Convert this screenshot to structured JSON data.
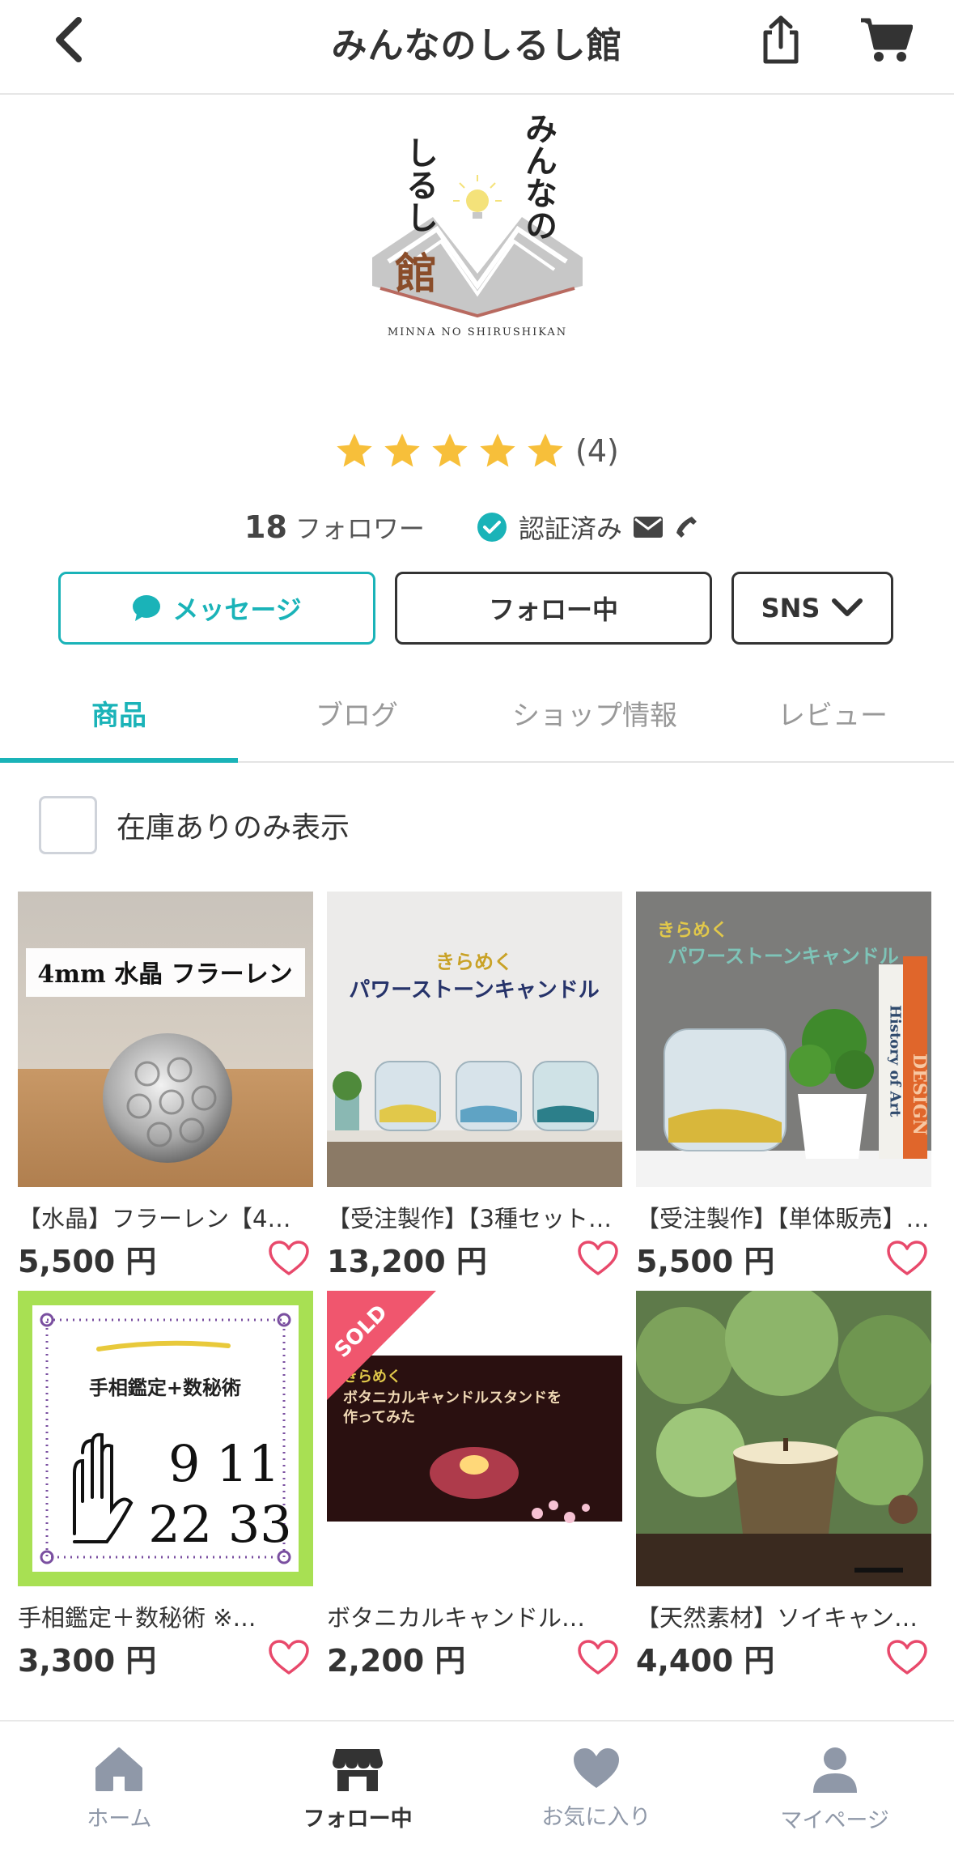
{
  "header": {
    "title": "みんなのしるし館"
  },
  "shop": {
    "logo": {
      "text_vertical_1": "みんなの",
      "text_vertical_2": "しるし",
      "text_kan": "館",
      "romaji": "MINNA NO SHIRUSHIKAN"
    },
    "rating": {
      "stars": 5,
      "count_text": "(4)"
    },
    "followers": {
      "count": "18",
      "label": "フォロワー"
    },
    "verified_label": "認証済み"
  },
  "buttons": {
    "message": "メッセージ",
    "follow": "フォロー中",
    "sns": "SNS"
  },
  "tabs": [
    {
      "label": "商品",
      "active": true
    },
    {
      "label": "ブログ",
      "active": false
    },
    {
      "label": "ショップ情報",
      "active": false
    },
    {
      "label": "レビュー",
      "active": false
    }
  ],
  "filter": {
    "in_stock_label": "在庫ありのみ表示",
    "checked": false
  },
  "products": [
    {
      "name": "【水晶】フラーレン【4m…",
      "price": "5,500 円",
      "image_caption": "4mm 水晶 フラーレン",
      "sold": false
    },
    {
      "name": "【受注製作】【3種セット…",
      "price": "13,200 円",
      "image_caption_top": "きらめく",
      "image_caption": "パワーストーンキャンドル",
      "sold": false
    },
    {
      "name": "【受注製作】【単体販売】…",
      "price": "5,500 円",
      "image_caption_top": "きらめく",
      "image_caption": "パワーストーンキャンドル",
      "book_text_1": "History of Art",
      "book_text_2": "DESIGN",
      "sold": false
    },
    {
      "name": "手相鑑定＋数秘術 ※…",
      "price": "3,300 円",
      "image_caption": "手相鑑定+数秘術",
      "image_numbers_1": "9 11",
      "image_numbers_2": "22 33",
      "sold": false
    },
    {
      "name": "ボタニカルキャンドル…",
      "price": "2,200 円",
      "image_caption_top": "きらめく",
      "image_caption": "ボタニカルキャンドルスタンドを",
      "image_caption_2": "作ってみた",
      "sold": true,
      "sold_label": "SOLD"
    },
    {
      "name": "【天然素材】ソイキャン…",
      "price": "4,400 円",
      "sold": false
    }
  ],
  "bottom_nav": [
    {
      "label": "ホーム",
      "icon": "home-icon",
      "active": false
    },
    {
      "label": "フォロー中",
      "icon": "shop-icon",
      "active": true
    },
    {
      "label": "お気に入り",
      "icon": "heart-icon",
      "active": false
    },
    {
      "label": "マイページ",
      "icon": "person-icon",
      "active": false
    }
  ],
  "colors": {
    "accent": "#1ab3b8",
    "star": "#f7bf3a",
    "heart": "#e8496b",
    "nav_inactive": "#8f98a8"
  }
}
